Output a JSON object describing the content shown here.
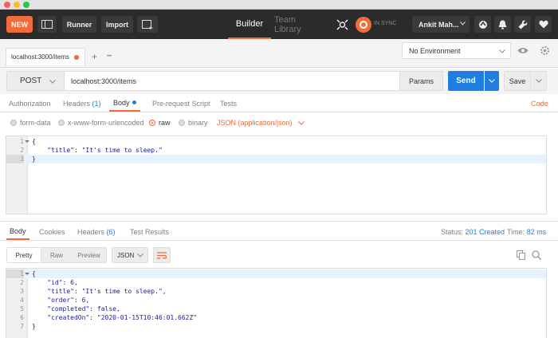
{
  "header": {
    "new_label": "NEW",
    "runner_label": "Runner",
    "import_label": "Import",
    "builder_label": "Builder",
    "team_library_label": "Team Library",
    "sync_label": "IN SYNC",
    "user_label": "Ankit Mah..."
  },
  "tabs": {
    "active_tab": "localhost:3000/items",
    "add_label": "+",
    "more_label": "•••",
    "environment": "No Environment"
  },
  "request": {
    "method": "POST",
    "url": "localhost:3000/items",
    "params_label": "Params",
    "send_label": "Send",
    "save_label": "Save"
  },
  "request_tabs": {
    "authorization": "Authorization",
    "headers": "Headers",
    "headers_count": "(1)",
    "body": "Body",
    "prerequest": "Pre-request Script",
    "tests": "Tests",
    "code": "Code"
  },
  "body_types": {
    "form_data": "form-data",
    "urlencoded": "x-www-form-urlencoded",
    "raw": "raw",
    "binary": "binary",
    "content_type": "JSON (application/json)"
  },
  "request_body": [
    {
      "num": "1",
      "text": "{"
    },
    {
      "num": "2",
      "text": "    \"title\": \"It's time to sleep.\""
    },
    {
      "num": "3",
      "text": "}"
    }
  ],
  "response_tabs": {
    "body": "Body",
    "cookies": "Cookies",
    "headers": "Headers",
    "headers_count": "(6)",
    "test_results": "Test Results",
    "status_label": "Status:",
    "status_value": "201 Created",
    "time_label": "Time:",
    "time_value": "82 ms"
  },
  "response_view": {
    "pretty": "Pretty",
    "raw": "Raw",
    "preview": "Preview",
    "format": "JSON"
  },
  "response_body": [
    {
      "num": "1",
      "text": "{"
    },
    {
      "num": "2",
      "text": "    \"id\": 6,"
    },
    {
      "num": "3",
      "text": "    \"title\": \"It's time to sleep.\","
    },
    {
      "num": "4",
      "text": "    \"order\": 6,"
    },
    {
      "num": "5",
      "text": "    \"completed\": false,"
    },
    {
      "num": "6",
      "text": "    \"createdOn\": \"2020-01-15T10:46:01.662Z\""
    },
    {
      "num": "7",
      "text": "}"
    }
  ],
  "colors": {
    "accent": "#f26b3a",
    "send": "#1f7ee0",
    "header_bg": "#2b2b2b",
    "status_value": "#1f7ee0"
  }
}
